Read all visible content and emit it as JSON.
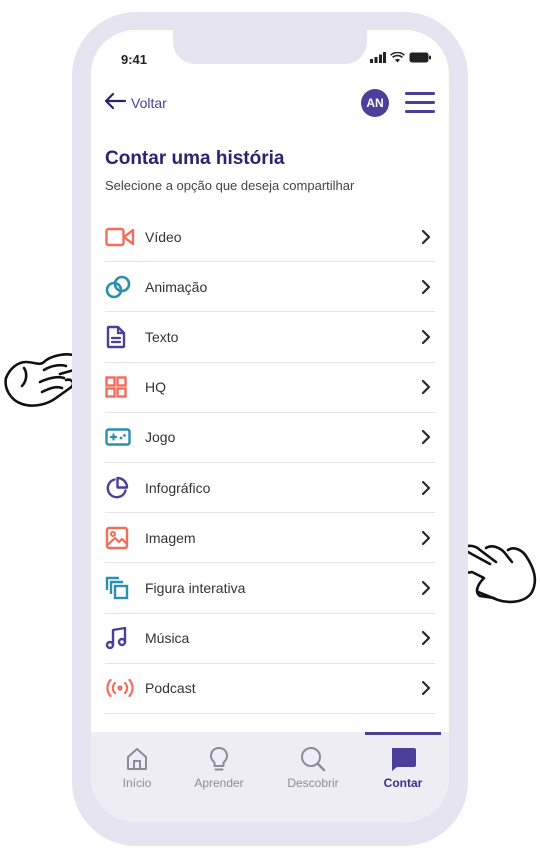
{
  "status_bar": {
    "time": "9:41"
  },
  "header": {
    "back_label": "Voltar",
    "avatar_initials": "AN"
  },
  "page": {
    "title": "Contar uma história",
    "subtitle": "Selecione a opção que deseja compartilhar"
  },
  "options": [
    {
      "label": "Vídeo",
      "icon": "video-camera-icon",
      "color": "#f26d5b"
    },
    {
      "label": "Animação",
      "icon": "animation-rings-icon",
      "color": "#2b8fb0"
    },
    {
      "label": "Texto",
      "icon": "document-text-icon",
      "color": "#4b3f9a"
    },
    {
      "label": "HQ",
      "icon": "comic-grid-icon",
      "color": "#f26d5b"
    },
    {
      "label": "Jogo",
      "icon": "gamepad-icon",
      "color": "#2b8fb0"
    },
    {
      "label": "Infográfico",
      "icon": "pie-chart-icon",
      "color": "#4b3f9a"
    },
    {
      "label": "Imagem",
      "icon": "image-icon",
      "color": "#f26d5b"
    },
    {
      "label": "Figura interativa",
      "icon": "layered-figure-icon",
      "color": "#2b8fb0"
    },
    {
      "label": "Música",
      "icon": "music-note-icon",
      "color": "#4b3f9a"
    },
    {
      "label": "Podcast",
      "icon": "broadcast-icon",
      "color": "#f26d5b"
    }
  ],
  "tabbar": {
    "tabs": [
      {
        "label": "Início",
        "icon": "home-icon"
      },
      {
        "label": "Aprender",
        "icon": "lightbulb-icon"
      },
      {
        "label": "Descobrir",
        "icon": "search-icon"
      },
      {
        "label": "Contar",
        "icon": "chat-bubble-icon"
      }
    ],
    "active": "Contar"
  },
  "colors": {
    "primary": "#4b3f9a",
    "title": "#2a2470",
    "coral": "#f26d5b",
    "teal": "#2b8fb0",
    "frame": "#e6e4f1"
  }
}
